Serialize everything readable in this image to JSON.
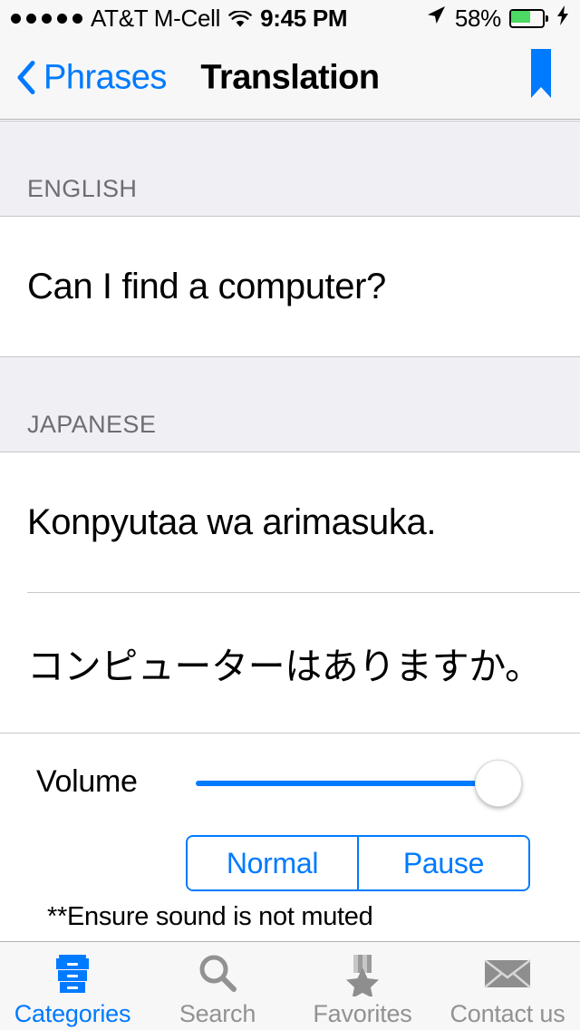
{
  "status_bar": {
    "signal_dots": 5,
    "carrier": "AT&T M-Cell",
    "wifi_icon": "wifi-icon",
    "time": "9:45 PM",
    "location_icon": "location-arrow-icon",
    "battery_percent": "58%",
    "battery_color": "#4CD964",
    "charging": true
  },
  "nav_bar": {
    "back_icon": "chevron-left-icon",
    "back_label": "Phrases",
    "title": "Translation",
    "bookmark_icon": "bookmark-icon",
    "accent_color": "#007AFF"
  },
  "sections": [
    {
      "header": "ENGLISH",
      "rows": [
        {
          "text": "Can I find a computer?"
        }
      ]
    },
    {
      "header": "JAPANESE",
      "rows": [
        {
          "text": "Konpyutaa wa arimasuka."
        },
        {
          "text": "コンピューターはありますか。"
        }
      ]
    }
  ],
  "controls": {
    "volume_label": "Volume",
    "volume_value": 100,
    "volume_min": 0,
    "volume_max": 100,
    "segments": [
      {
        "label": "Normal",
        "selected": false
      },
      {
        "label": "Pause",
        "selected": false
      }
    ],
    "note": "**Ensure sound is not muted"
  },
  "tab_bar": {
    "items": [
      {
        "label": "Categories",
        "icon": "file-cabinet-icon",
        "active": true
      },
      {
        "label": "Search",
        "icon": "search-icon",
        "active": false
      },
      {
        "label": "Favorites",
        "icon": "medal-star-icon",
        "active": false
      },
      {
        "label": "Contact us",
        "icon": "envelope-icon",
        "active": false
      }
    ],
    "active_color": "#007AFF",
    "inactive_color": "#929292"
  }
}
